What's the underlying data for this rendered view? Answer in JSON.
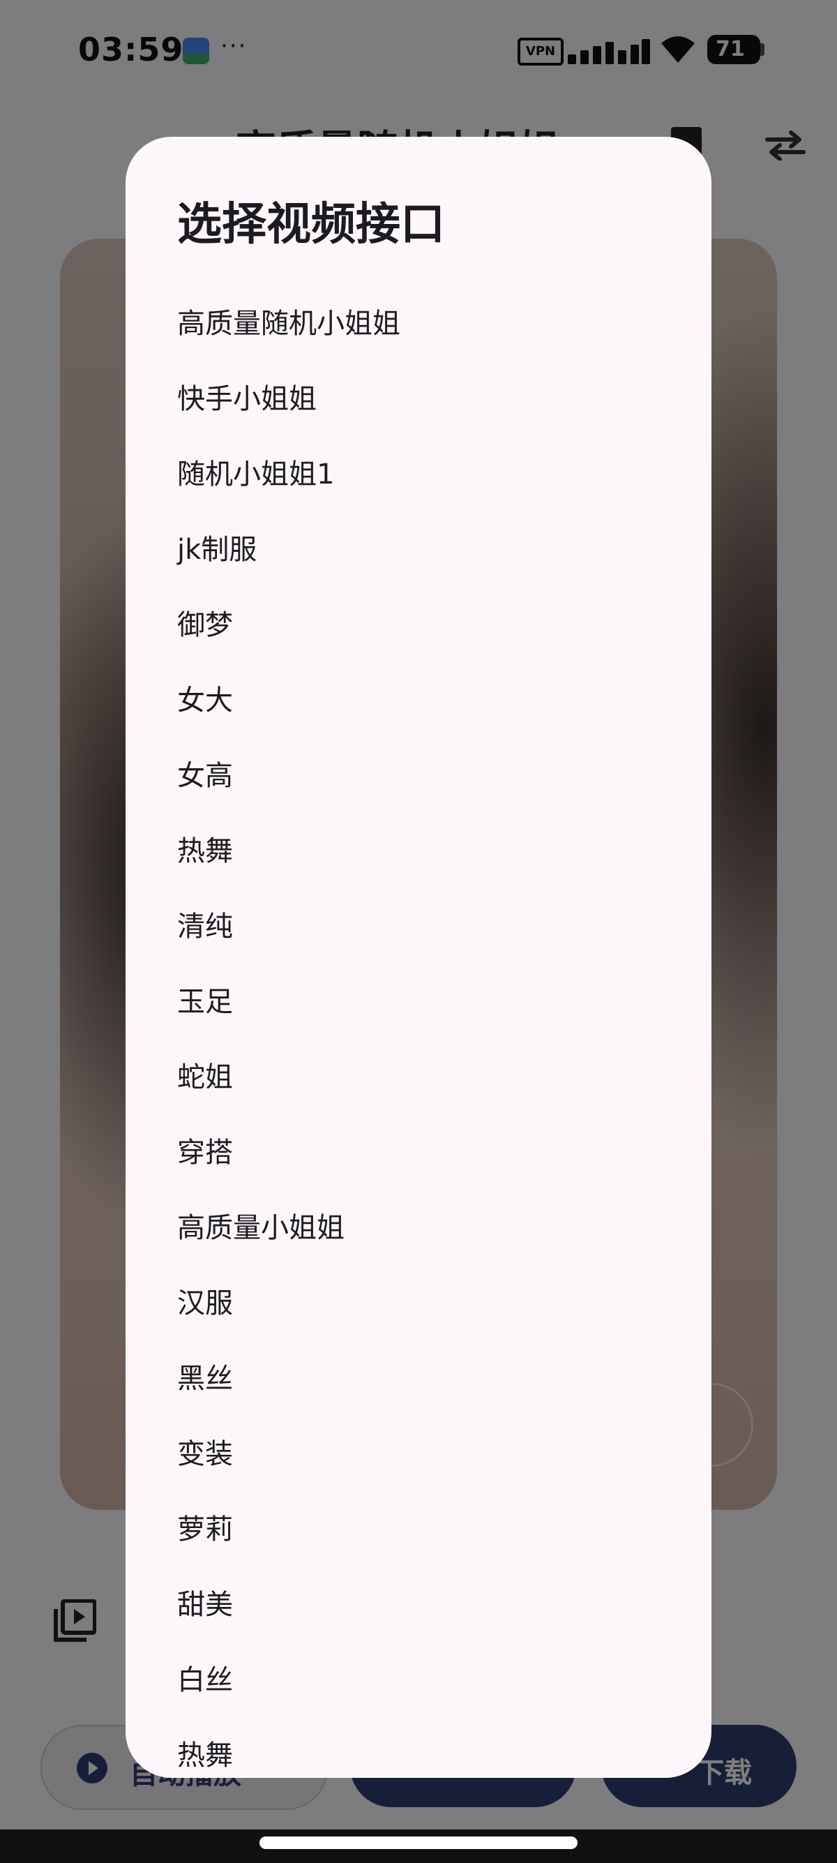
{
  "status_bar": {
    "time": "03:59",
    "overflow": "···",
    "vpn": "VPN",
    "battery": "71"
  },
  "header": {
    "title": "高质量随机小姐姐"
  },
  "bottom_bar": {
    "autoplay_label": "自动播放",
    "download_label": "下载"
  },
  "dialog": {
    "title": "选择视频接口",
    "options": [
      "高质量随机小姐姐",
      "快手小姐姐",
      "随机小姐姐1",
      "jk制服",
      "御梦",
      "女大",
      "女高",
      "热舞",
      "清纯",
      "玉足",
      "蛇姐",
      "穿搭",
      "高质量小姐姐",
      "汉服",
      "黑丝",
      "变装",
      "萝莉",
      "甜美",
      "白丝",
      "热舞"
    ]
  },
  "colors": {
    "accent": "#2c3e6f",
    "dialog_surface": "#fdf7fb",
    "scrim": "rgba(0,0,0,0.5)"
  },
  "icons": {
    "swap": "swap-horiz-icon",
    "playlist": "video-library-icon",
    "play": "play-circle-icon"
  }
}
